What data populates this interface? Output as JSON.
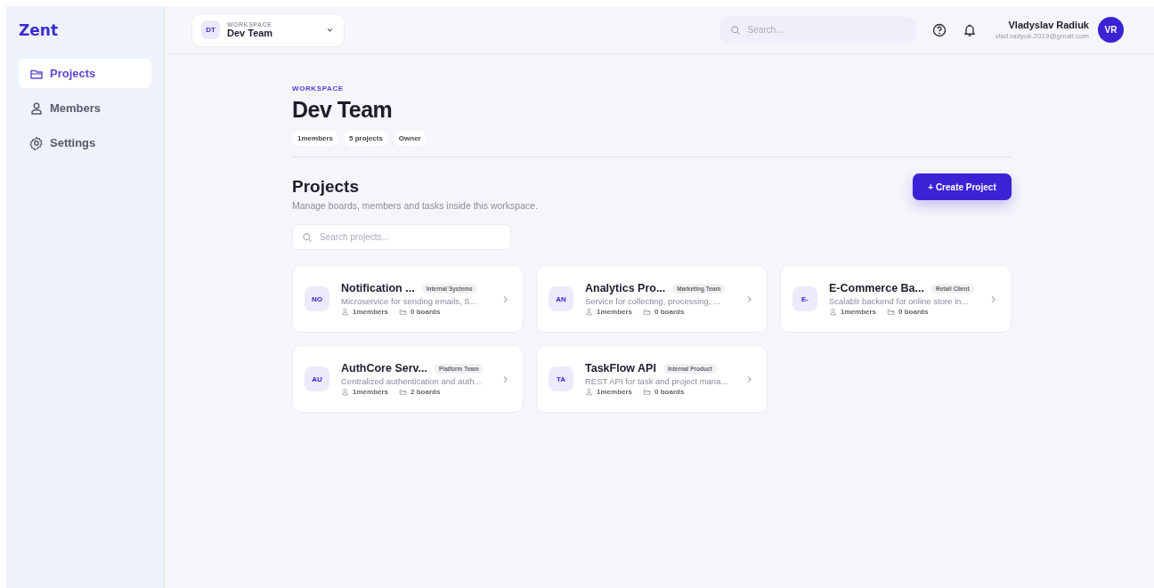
{
  "brand": "Zent",
  "sidebar": {
    "items": [
      {
        "label": "Projects",
        "kind": "folder",
        "selected": true
      },
      {
        "label": "Members",
        "kind": "user",
        "selected": false
      },
      {
        "label": "Settings",
        "kind": "gear",
        "selected": false
      }
    ]
  },
  "header": {
    "workspace_switcher": {
      "initials": "DT",
      "caption": "WORKSPACE",
      "name": "Dev Team"
    },
    "search": {
      "placeholder": "Search..."
    },
    "user": {
      "name": "Vladyslav Radiuk",
      "email": "vlad.radyuk.2019@gmail.com",
      "initials": "VR"
    }
  },
  "workspace": {
    "eyebrow": "WORKSPACE",
    "title": "Dev Team",
    "chips": [
      "1members",
      "5 projects",
      "Owner"
    ]
  },
  "projects": {
    "title": "Projects",
    "subtitle": "Manage boards, members and tasks inside this workspace.",
    "create_button": "+ Create Project",
    "search": {
      "placeholder": "Search projects..."
    },
    "cards": [
      {
        "initials": "NO",
        "name": "Notification ...",
        "tag": "Internal Systems",
        "description": "Microservice for sending emails, S...",
        "members": "1members",
        "boards": "0 boards"
      },
      {
        "initials": "AN",
        "name": "Analytics Pro...",
        "tag": "Marketing Team",
        "description": "Service for collecting, processing, ...",
        "members": "1members",
        "boards": "0 boards"
      },
      {
        "initials": "E-",
        "name": "E-Commerce Ba...",
        "tag": "Retail Client",
        "description": "Scalablr backend for online store in...",
        "members": "1members",
        "boards": "0 boards"
      },
      {
        "initials": "AU",
        "name": "AuthCore Serv...",
        "tag": "Platform Team",
        "description": "Centralized authentication and auth...",
        "members": "1members",
        "boards": "2 boards"
      },
      {
        "initials": "TA",
        "name": "TaskFlow API",
        "tag": "Internal Product",
        "description": "REST API for task and project mana...",
        "members": "1members",
        "boards": "0 boards"
      }
    ]
  }
}
